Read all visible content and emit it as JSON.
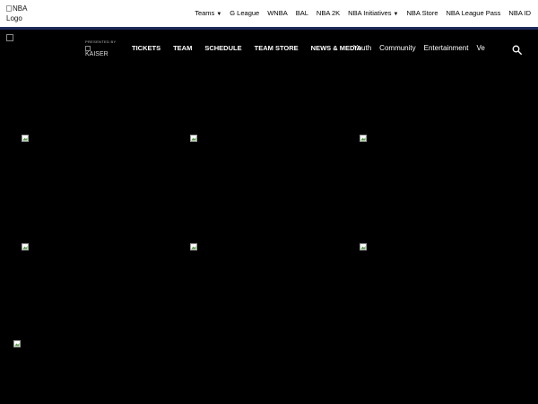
{
  "topbar": {
    "logo_alt": "NBA Logo",
    "links": [
      {
        "label": "Teams",
        "caret": "▼"
      },
      {
        "label": "G League"
      },
      {
        "label": "WNBA"
      },
      {
        "label": "BAL"
      },
      {
        "label": "NBA 2K"
      },
      {
        "label": "NBA Initiatives",
        "caret": "▼"
      },
      {
        "label": "NBA Store"
      },
      {
        "label": "NBA League Pass"
      },
      {
        "label": "NBA ID"
      }
    ]
  },
  "teamnav": {
    "presented_by": "PRESENTED BY",
    "sponsor_text": "KAISER",
    "main_items": [
      "TICKETS",
      "TEAM",
      "SCHEDULE",
      "TEAM STORE",
      "NEWS & MEDIA"
    ],
    "sub_items": [
      "Youth",
      "Community",
      "Entertainment",
      "Ve"
    ],
    "search_icon": "search-icon"
  },
  "colors": {
    "page_bg": "#000000",
    "topbar_bg": "#ffffff",
    "accent_line": "#1d2a5b"
  },
  "images": {
    "count": 7,
    "icon": "broken-image-icon"
  }
}
